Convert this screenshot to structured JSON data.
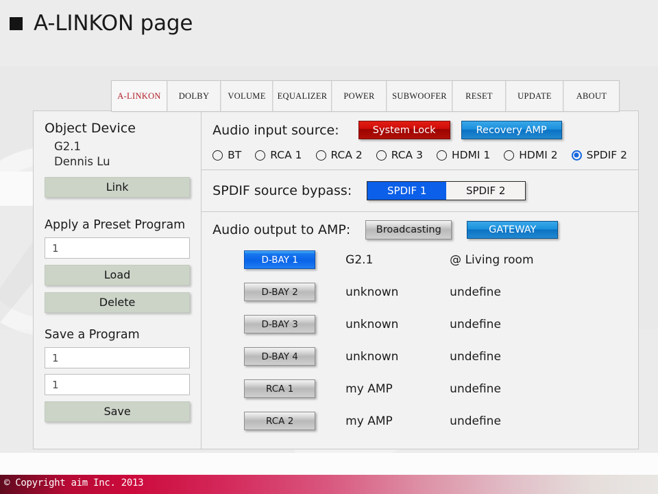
{
  "page": {
    "title": "A-LINKON page",
    "bullet_icon": "square-bullet-icon"
  },
  "tabs": [
    {
      "label": "A-LINKON",
      "active": true
    },
    {
      "label": "DOLBY",
      "active": false
    },
    {
      "label": "VOLUME",
      "active": false
    },
    {
      "label": "EQUALIZER",
      "active": false
    },
    {
      "label": "POWER",
      "active": false
    },
    {
      "label": "SUBWOOFER",
      "active": false
    },
    {
      "label": "RESET",
      "active": false
    },
    {
      "label": "UPDATE",
      "active": false
    },
    {
      "label": "ABOUT",
      "active": false
    }
  ],
  "sidebar": {
    "object_device_heading": "Object Device",
    "device_name": "G2.1",
    "device_owner": "Dennis Lu",
    "link_button": "Link",
    "preset_heading": "Apply a Preset Program",
    "preset_value": "1",
    "load_button": "Load",
    "delete_button": "Delete",
    "save_heading": "Save a Program",
    "save_value_1": "1",
    "save_value_2": "1",
    "save_button": "Save"
  },
  "input_source": {
    "label": "Audio input source:",
    "system_lock_button": "System Lock",
    "recovery_amp_button": "Recovery AMP",
    "options": [
      {
        "label": "BT",
        "selected": false
      },
      {
        "label": "RCA 1",
        "selected": false
      },
      {
        "label": "RCA 2",
        "selected": false
      },
      {
        "label": "RCA 3",
        "selected": false
      },
      {
        "label": "HDMI 1",
        "selected": false
      },
      {
        "label": "HDMI 2",
        "selected": false
      },
      {
        "label": "SPDIF 2",
        "selected": true
      }
    ]
  },
  "spdif_bypass": {
    "label": "SPDIF source bypass:",
    "segments": [
      {
        "label": "SPDIF 1",
        "selected": true
      },
      {
        "label": "SPDIF 2",
        "selected": false
      }
    ]
  },
  "audio_output": {
    "label": "Audio output to AMP:",
    "broadcasting_button": "Broadcasting",
    "gateway_button": "GATEWAY",
    "rows": [
      {
        "button": "D-BAY 1",
        "device": "G2.1",
        "location": "@ Living room",
        "active": true
      },
      {
        "button": "D-BAY 2",
        "device": "unknown",
        "location": "undefine",
        "active": false
      },
      {
        "button": "D-BAY 3",
        "device": "unknown",
        "location": "undefine",
        "active": false
      },
      {
        "button": "D-BAY 4",
        "device": "unknown",
        "location": "undefine",
        "active": false
      },
      {
        "button": "RCA 1",
        "device": "my AMP",
        "location": "undefine",
        "active": false
      },
      {
        "button": "RCA 2",
        "device": "my AMP",
        "location": "undefine",
        "active": false
      }
    ]
  },
  "footer": {
    "copyright": "© Copyright aim Inc. 2013"
  },
  "colors": {
    "accent_red": "#b01e28",
    "button_red": "#cf0d08",
    "button_blue": "#1b90dd",
    "toggle_blue": "#0b5fe8",
    "sage": "#ccd4c8",
    "background": "#e9e9e9"
  }
}
